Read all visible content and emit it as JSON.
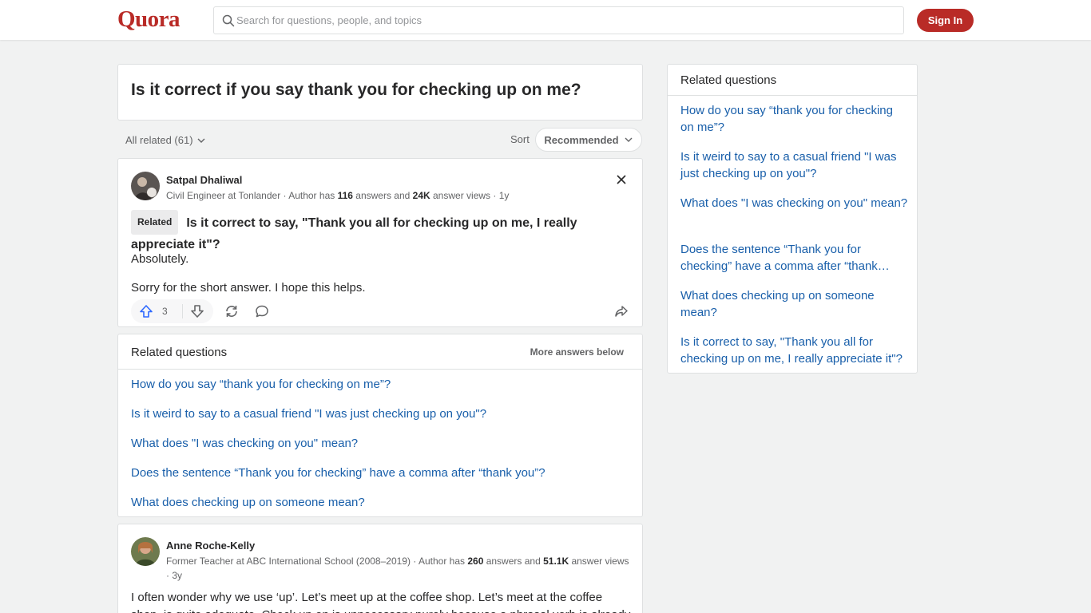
{
  "header": {
    "logo": "Quora",
    "search_placeholder": "Search for questions, people, and topics",
    "signin_label": "Sign In"
  },
  "question": {
    "title": "Is it correct if you say thank you for checking up on me?"
  },
  "filters": {
    "all_related": "All related (61)",
    "sort_label": "Sort",
    "sort_value": "Recommended"
  },
  "answer1": {
    "author": "Satpal Dhaliwal",
    "meta_prefix": "Civil Engineer at Tonlander · Author has ",
    "answers_count": "116",
    "meta_mid": " answers and ",
    "views_count": "24K",
    "meta_suffix": " answer views · 1y",
    "related_badge": "Related",
    "related_question": "Is it correct to say, \"Thank you all for checking up on me, I really appreciate it\"?",
    "body_line1": "Absolutely.",
    "body_line2": "Sorry for the short answer. I hope this helps.",
    "upvotes": "3"
  },
  "related_main": {
    "title": "Related questions",
    "more": "More answers below",
    "items": [
      "How do you say “thank you for checking on me”?",
      "Is it weird to say to a casual friend \"I was just checking up on you\"?",
      "What does \"I was checking on you\" mean?",
      "Does the sentence “Thank you for checking” have a comma after “thank you”?",
      "What does checking up on someone mean?"
    ]
  },
  "answer2": {
    "author": "Anne Roche-Kelly",
    "meta_prefix": "Former Teacher at ABC International School (2008–2019) · Author has ",
    "answers_count": "260",
    "meta_mid": " answers and ",
    "views_count": "51.1K",
    "meta_suffix": " answer views · 3y",
    "body_line1": "I often wonder why we use ‘up’. Let’s meet up at the coffee shop. Let’s meet at the coffee",
    "body_line2": "shop, is quite adequate. Check up on is unnecessary purely because a phrasal verb is already"
  },
  "sidebar": {
    "title": "Related questions",
    "items": [
      "How do you say “thank you for checking on me”?",
      "Is it weird to say to a casual friend \"I was just checking up on you\"?",
      "What does \"I was checking on you\" mean?",
      "Does the sentence “Thank you for checking” have a comma after “thank…",
      "What does checking up on someone mean?",
      "Is it correct to say, \"Thank you all for checking up on me, I really appreciate it\"?"
    ]
  },
  "colors": {
    "brand": "#b92b27",
    "link": "#195faa",
    "upvote": "#2e69ff"
  }
}
